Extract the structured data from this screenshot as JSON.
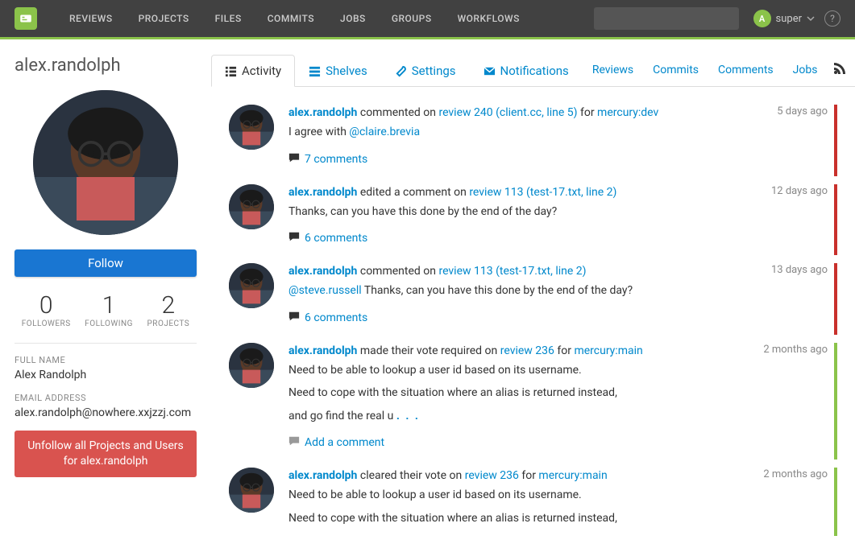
{
  "nav": {
    "items": [
      "REVIEWS",
      "PROJECTS",
      "FILES",
      "COMMITS",
      "JOBS",
      "GROUPS",
      "WORKFLOWS"
    ],
    "user": "super"
  },
  "profile": {
    "username": "alex.randolph",
    "follow_label": "Follow",
    "stats": {
      "followers": {
        "n": "0",
        "l": "FOLLOWERS"
      },
      "following": {
        "n": "1",
        "l": "FOLLOWING"
      },
      "projects": {
        "n": "2",
        "l": "PROJECTS"
      }
    },
    "fullname_label": "FULL NAME",
    "fullname": "Alex Randolph",
    "email_label": "EMAIL ADDRESS",
    "email": "alex.randolph@nowhere.xxjzzj.com",
    "unfollow_label": "Unfollow all Projects and Users for alex.randolph"
  },
  "tabs": {
    "activity": "Activity",
    "shelves": "Shelves",
    "settings": "Settings",
    "notifications": "Notifications",
    "reviews": "Reviews",
    "commits": "Commits",
    "comments": "Comments",
    "jobs": "Jobs"
  },
  "feed": [
    {
      "user": "alex.randolph",
      "action": " commented on ",
      "target": "review 240 (client.cc, line 5)",
      "suffix": " for ",
      "suffix_link": "mercury:dev",
      "time": "5 days ago",
      "body_prefix": "I agree with ",
      "body_link": "@claire.brevia",
      "foot_link": "7 comments",
      "bar": "red"
    },
    {
      "user": "alex.randolph",
      "action": " edited a comment on ",
      "target": "review 113 (test-17.txt, line 2)",
      "time": "12 days ago",
      "body_plain": "Thanks, can you have this done by the end of the day?",
      "foot_link": "6 comments",
      "bar": "red"
    },
    {
      "user": "alex.randolph",
      "action": " commented on ",
      "target": "review 113 (test-17.txt, line 2)",
      "time": "13 days ago",
      "body_link_first": "@steve.russell",
      "body_after": " Thanks, can you have this done by the end of the day?",
      "foot_link": "6 comments",
      "bar": "red"
    },
    {
      "user": "alex.randolph",
      "action": " made their vote required on ",
      "target": "review 236",
      "suffix": " for ",
      "suffix_link": "mercury:main",
      "time": "2 months ago",
      "body_multi": [
        "Need to be able to lookup a user id based on its username.",
        "Need to cope with the situation where an alias is returned instead,",
        "and go find the real u"
      ],
      "ellipsis": ". . .",
      "foot_muted": "Add a comment",
      "bar": "green"
    },
    {
      "user": "alex.randolph",
      "action": " cleared their vote on ",
      "target": "review 236",
      "suffix": " for ",
      "suffix_link": "mercury:main",
      "time": "2 months ago",
      "body_multi": [
        "Need to be able to lookup a user id based on its username.",
        "Need to cope with the situation where an alias is returned instead,"
      ],
      "bar": "green"
    }
  ]
}
